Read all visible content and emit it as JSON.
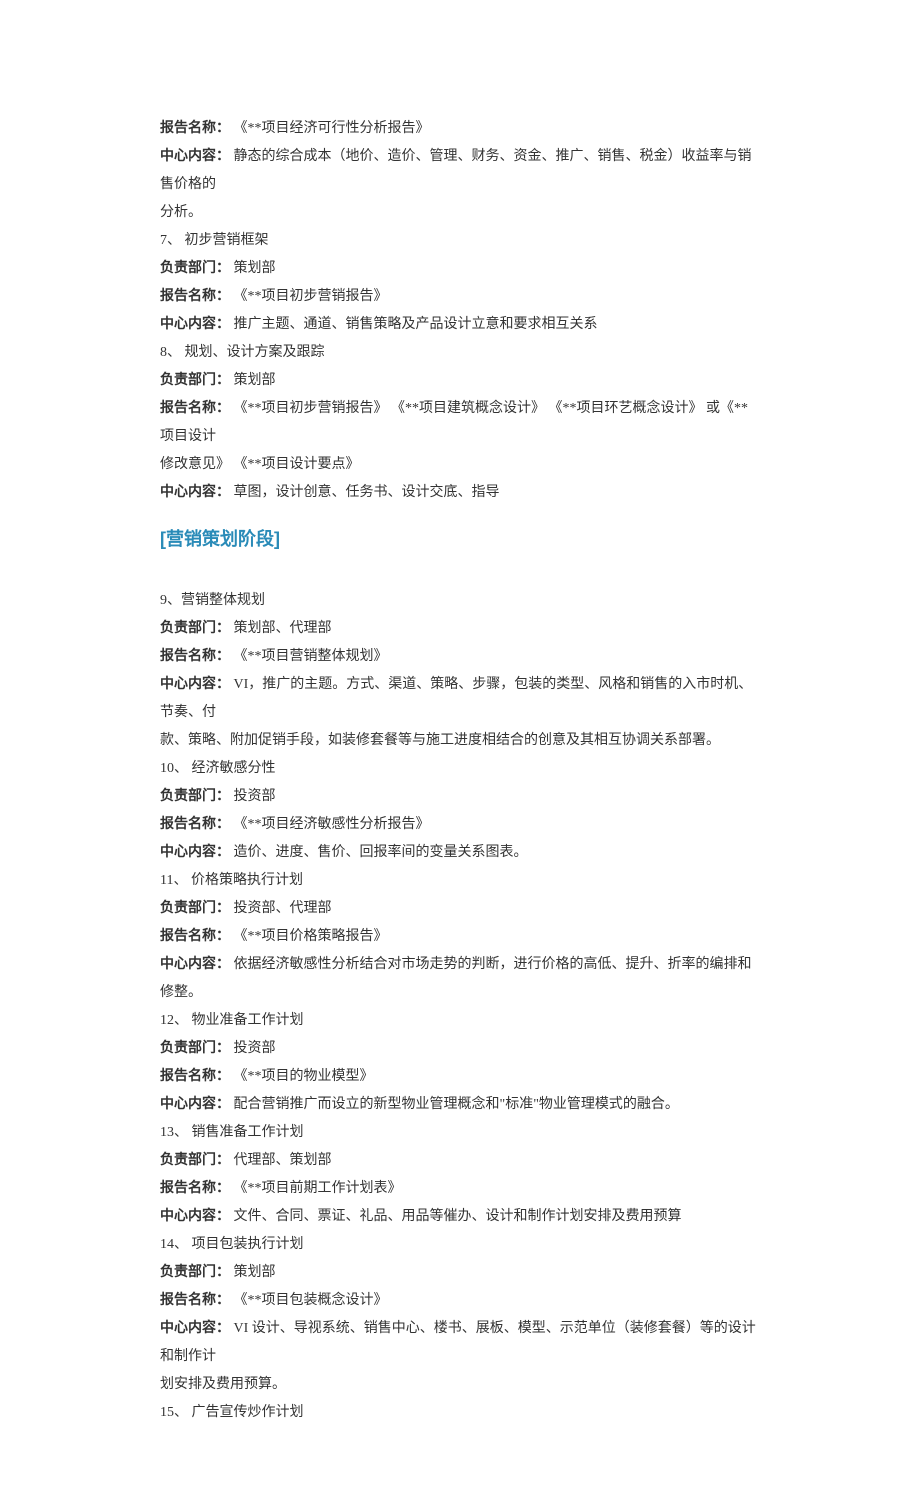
{
  "items6": {
    "reportLabel": "报告名称：",
    "reportValue": "《**项目经济可行性分析报告》",
    "contentLabel": "中心内容：",
    "contentValue1": "静态的综合成本（地价、造价、管理、财务、资金、推广、销售、税金）收益率与销售价格的",
    "contentValue2": "分析。"
  },
  "item7": {
    "num": "7、 初步营销框架",
    "deptLabel": "负责部门：",
    "deptValue": "策划部",
    "reportLabel": "报告名称：",
    "reportValue": "《**项目初步营销报告》",
    "contentLabel": "中心内容：",
    "contentValue": "推广主题、通道、销售策略及产品设计立意和要求相互关系"
  },
  "item8": {
    "num": "8、 规划、设计方案及跟踪",
    "deptLabel": "负责部门：",
    "deptValue": "策划部",
    "reportLabel": "报告名称：",
    "reportValue1": "《**项目初步营销报告》 《**项目建筑概念设计》 《**项目环艺概念设计》 或《**项目设计",
    "reportValue2": "修改意见》 《**项目设计要点》",
    "contentLabel": "中心内容：",
    "contentValue": "草图，设计创意、任务书、设计交底、指导"
  },
  "sectionHeading": "[营销策划阶段]",
  "item9": {
    "num": "9、营销整体规划",
    "deptLabel": "负责部门：",
    "deptValue": "策划部、代理部",
    "reportLabel": "报告名称：",
    "reportValue": "《**项目营销整体规划》",
    "contentLabel": "中心内容：",
    "contentValue1": "VI，推广的主题。方式、渠道、策略、步骤，包装的类型、风格和销售的入市时机、节奏、付",
    "contentValue2": "款、策略、附加促销手段，如装修套餐等与施工进度相结合的创意及其相互协调关系部署。"
  },
  "item10": {
    "num": "10、 经济敏感分性",
    "deptLabel": "负责部门：",
    "deptValue": "投资部",
    "reportLabel": "报告名称：",
    "reportValue": "《**项目经济敏感性分析报告》",
    "contentLabel": "中心内容：",
    "contentValue": "造价、进度、售价、回报率间的变量关系图表。"
  },
  "item11": {
    "num": "11、 价格策略执行计划",
    "deptLabel": "负责部门：",
    "deptValue": "投资部、代理部",
    "reportLabel": "报告名称：",
    "reportValue": "《**项目价格策略报告》",
    "contentLabel": "中心内容：",
    "contentValue": "依据经济敏感性分析结合对市场走势的判断，进行价格的高低、提升、折率的编排和修整。"
  },
  "item12": {
    "num": "12、 物业准备工作计划",
    "deptLabel": "负责部门：",
    "deptValue": "投资部",
    "reportLabel": "报告名称：",
    "reportValue": "《**项目的物业模型》",
    "contentLabel": "中心内容：",
    "contentValue": "配合营销推广而设立的新型物业管理概念和\"标准\"物业管理模式的融合。"
  },
  "item13": {
    "num": "13、 销售准备工作计划",
    "deptLabel": "负责部门：",
    "deptValue": "代理部、策划部",
    "reportLabel": "报告名称：",
    "reportValue": "《**项目前期工作计划表》",
    "contentLabel": "中心内容：",
    "contentValue": "文件、合同、票证、礼品、用品等催办、设计和制作计划安排及费用预算"
  },
  "item14": {
    "num": "14、 项目包装执行计划",
    "deptLabel": "负责部门：",
    "deptValue": "策划部",
    "reportLabel": "报告名称：",
    "reportValue": "《**项目包装概念设计》",
    "contentLabel": "中心内容：",
    "contentValue1": "VI 设计、导视系统、销售中心、楼书、展板、模型、示范单位（装修套餐）等的设计和制作计",
    "contentValue2": "划安排及费用预算。"
  },
  "item15": {
    "num": "15、 广告宣传炒作计划"
  }
}
